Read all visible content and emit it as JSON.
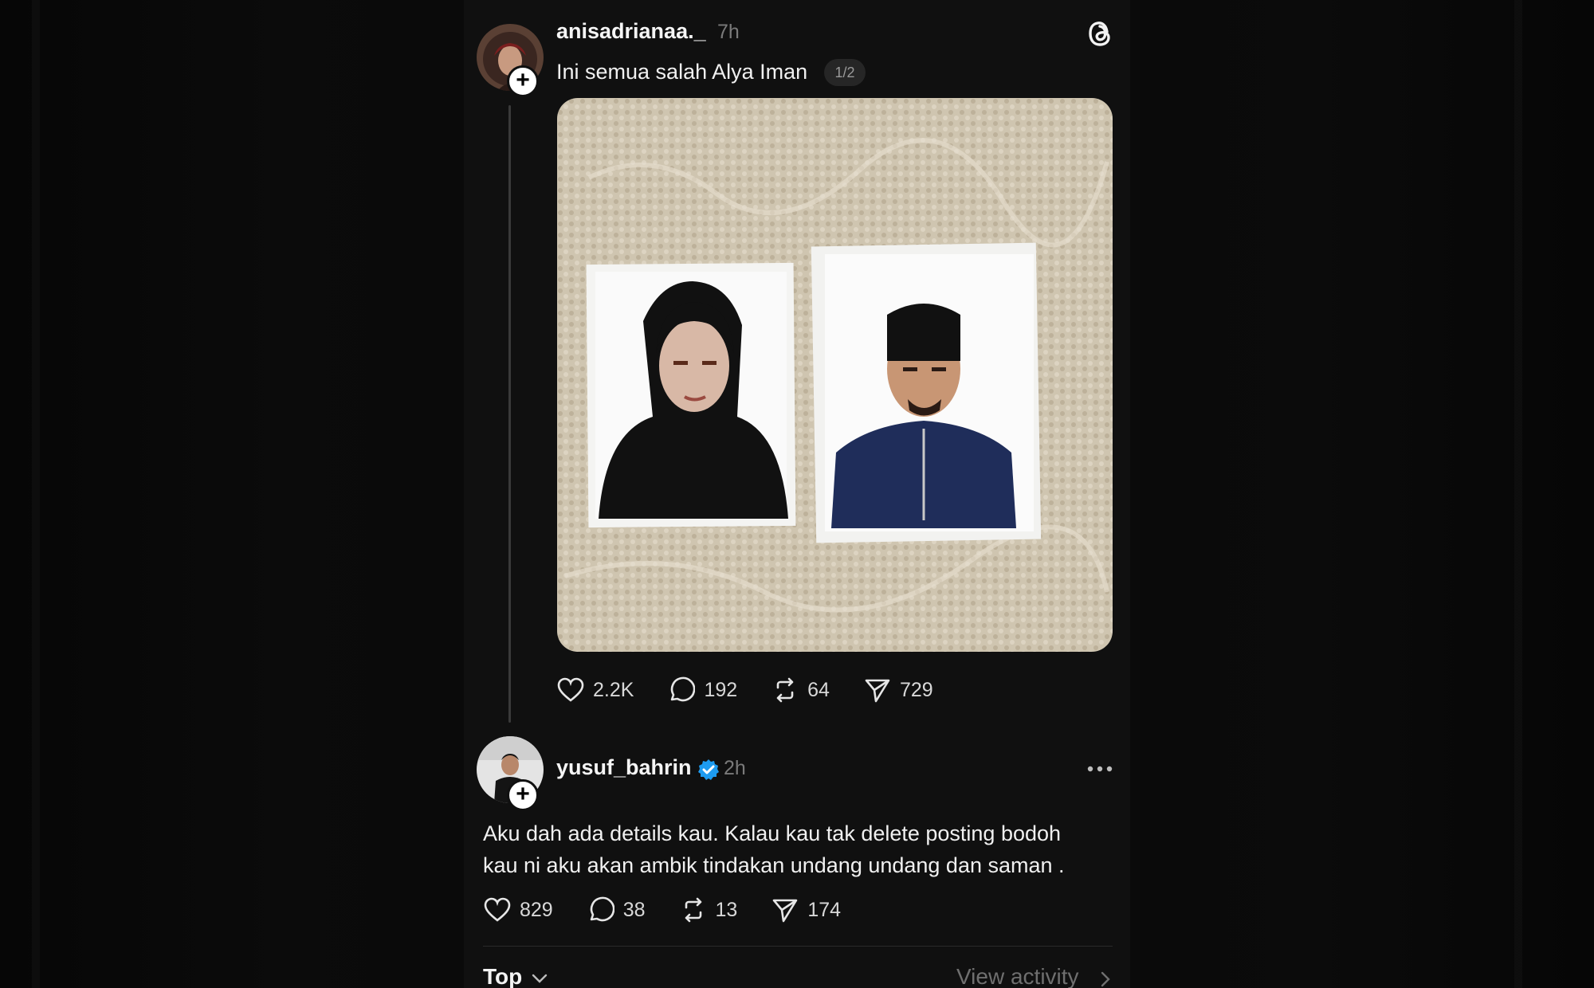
{
  "post": {
    "username": "anisadrianaa._",
    "time": "7h",
    "text": "Ini semua salah Alya Iman",
    "page_indicator": "1/2",
    "image_description_icon": "photo-image",
    "stats": {
      "likes": "2.2K",
      "replies": "192",
      "reposts": "64",
      "shares": "729"
    }
  },
  "reply": {
    "username": "yusuf_bahrin",
    "verified": true,
    "time": "2h",
    "text_line1": "Aku dah ada details kau. Kalau kau tak delete posting bodoh",
    "text_line2": "kau ni aku akan ambik tindakan undang undang dan saman .",
    "stats": {
      "likes": "829",
      "replies": "38",
      "reposts": "13",
      "shares": "174"
    }
  },
  "footer": {
    "sort_label": "Top",
    "activity_label": "View activity"
  },
  "colors": {
    "accent_verified": "#1d9bf0",
    "panel": "#101010"
  }
}
